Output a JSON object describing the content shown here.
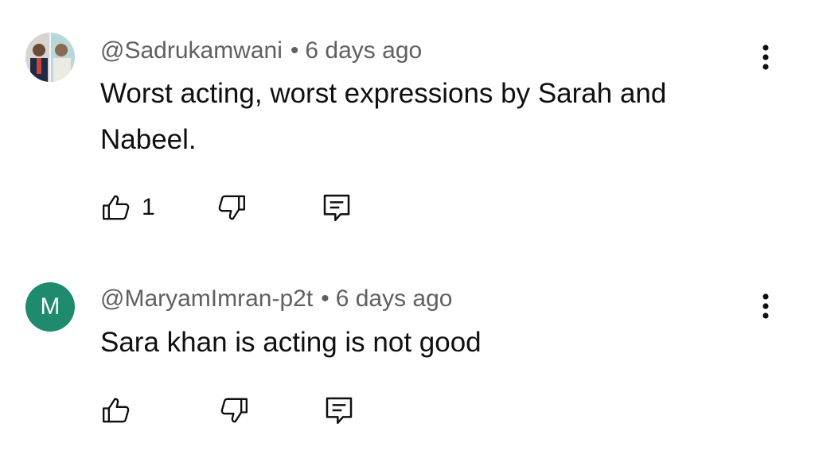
{
  "comments": [
    {
      "author": "@Sadrukamwani",
      "separator": "•",
      "time": "6 days ago",
      "text": "Worst acting, worst expressions by Sarah and Nabeel.",
      "likes": "1",
      "avatar_type": "photo"
    },
    {
      "author": "@MaryamImran-p2t",
      "separator": "•",
      "time": "6 days ago",
      "text": "Sara khan is acting is not good",
      "likes": "",
      "avatar_type": "letter",
      "avatar_letter": "M",
      "avatar_color": "#1e8a6e"
    }
  ],
  "icons": {
    "like": "thumbs-up-icon",
    "dislike": "thumbs-down-icon",
    "reply": "reply-comment-icon",
    "menu": "more-vert-icon"
  }
}
